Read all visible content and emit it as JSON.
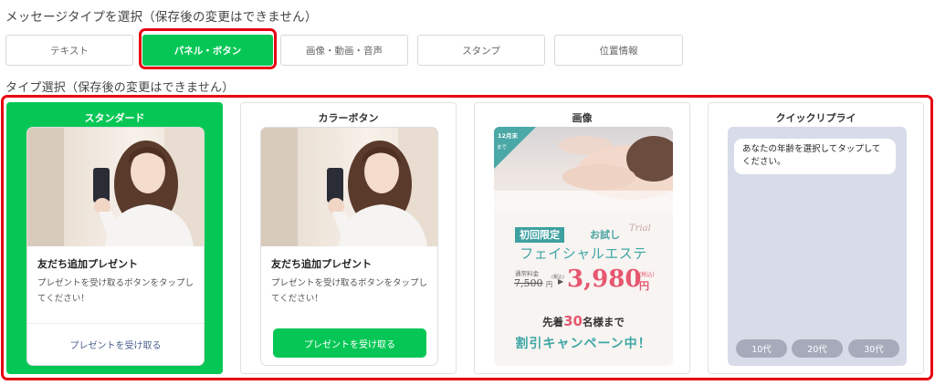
{
  "message_type_heading": "メッセージタイプを選択（保存後の変更はできません）",
  "message_tabs": [
    "テキスト",
    "パネル・ボタン",
    "画像・動画・音声",
    "スタンプ",
    "位置情報"
  ],
  "type_heading": "タイプ選択（保存後の変更はできません）",
  "types": {
    "standard": {
      "title": "スタンダード",
      "card_title": "友だち追加プレゼント",
      "card_body": "プレゼントを受け取るボタンをタップしてください！",
      "button": "プレゼントを受け取る"
    },
    "color_button": {
      "title": "カラーボタン",
      "card_title": "友だち追加プレゼント",
      "card_body": "プレゼントを受け取るボタンをタップしてください！",
      "button": "プレゼントを受け取る"
    },
    "image": {
      "title": "画像",
      "corner_date": "12月末",
      "corner_until": "まで",
      "tag": "初回限定",
      "trial": "お試し",
      "trial_script": "Trial",
      "service": "フェイシャルエステ",
      "regular_label": "通常料金",
      "old_price": "7,500",
      "old_unit": "円",
      "tax_label": "(税込)",
      "arrow": "▶",
      "new_price": "3,980",
      "new_unit": "円",
      "first_pre": "先着",
      "first_num": "30",
      "first_post": "名様まで",
      "campaign": "割引キャンペーン中！"
    },
    "quick_reply": {
      "title": "クイックリプライ",
      "message": "あなたの年齢を選択してタップしてください。",
      "options": [
        "10代",
        "20代",
        "30代"
      ]
    }
  },
  "colors": {
    "line_green": "#06c755",
    "highlight_red": "#e60012",
    "teal": "#3da7a5",
    "pink": "#e6576f"
  }
}
